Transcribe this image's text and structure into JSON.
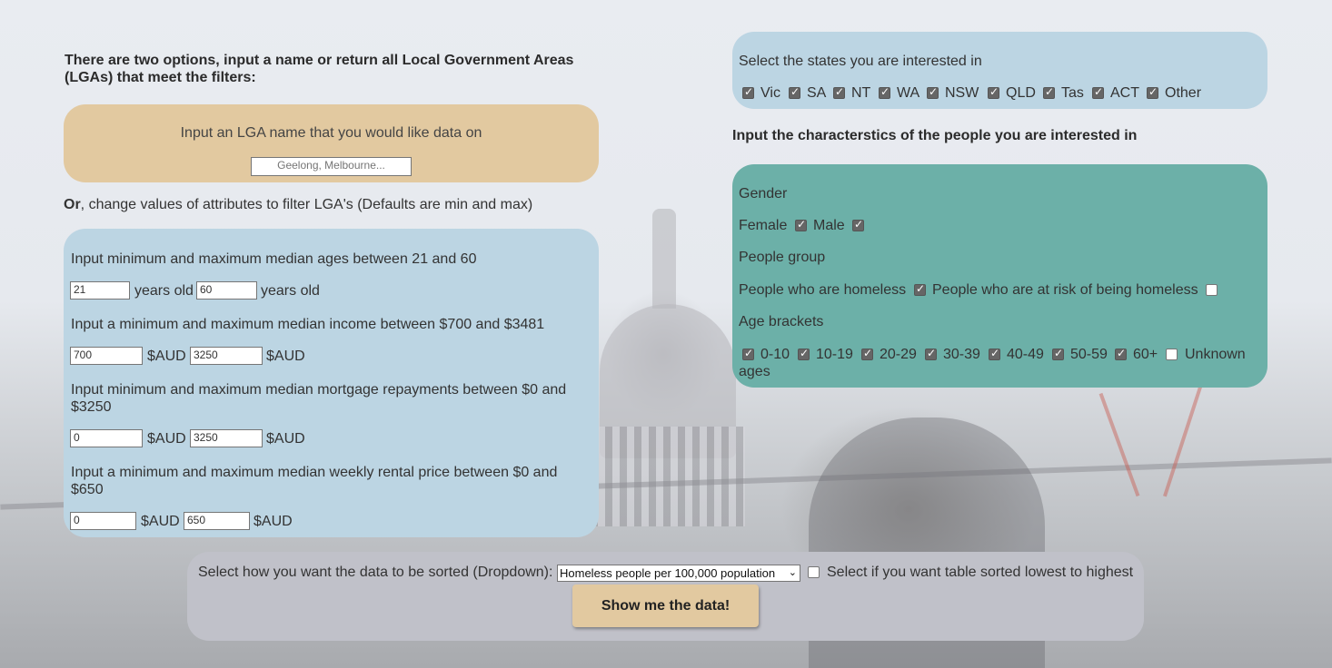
{
  "intro": "There are two options, input a name or return all Local Government Areas (LGAs) that meet the filters:",
  "lga": {
    "label": "Input an LGA name that you would like data on",
    "placeholder": "Geelong, Melbourne..."
  },
  "or_line": {
    "bold": "Or",
    "rest": ", change values of attributes to filter LGA's (Defaults are min and max)"
  },
  "attributes": {
    "age_label": "Input minimum and maximum median ages between 21 and 60",
    "age_min": "21",
    "age_max": "60",
    "years_old": "years old",
    "income_label": "Input a minimum and maximum median income between $700 and $3481",
    "income_min": "700",
    "income_max": "3250",
    "mortgage_label": "Input minimum and maximum median mortgage repayments between $0 and $3250",
    "mortgage_min": "0",
    "mortgage_max": "3250",
    "rent_label": "Input a minimum and maximum median weekly rental price between $0 and $650",
    "rent_min": "0",
    "rent_max": "650",
    "currency": "$AUD"
  },
  "states": {
    "label": "Select the states you are interested in",
    "items": [
      {
        "label": "Vic",
        "checked": true
      },
      {
        "label": "SA",
        "checked": true
      },
      {
        "label": "NT",
        "checked": true
      },
      {
        "label": "WA",
        "checked": true
      },
      {
        "label": "NSW",
        "checked": true
      },
      {
        "label": "QLD",
        "checked": true
      },
      {
        "label": "Tas",
        "checked": true
      },
      {
        "label": "ACT",
        "checked": true
      },
      {
        "label": "Other",
        "checked": true
      }
    ]
  },
  "characteristics_title": "Input the characterstics of the people you are interested in",
  "people": {
    "gender_label": "Gender",
    "female": "Female",
    "male": "Male",
    "group_label": "People group",
    "homeless": "People who are homeless",
    "at_risk": "People who are at risk of being homeless",
    "age_brackets_label": "Age brackets",
    "brackets": [
      {
        "label": "0-10",
        "checked": true
      },
      {
        "label": "10-19",
        "checked": true
      },
      {
        "label": "20-29",
        "checked": true
      },
      {
        "label": "30-39",
        "checked": true
      },
      {
        "label": "40-49",
        "checked": true
      },
      {
        "label": "50-59",
        "checked": true
      },
      {
        "label": "60+",
        "checked": true
      },
      {
        "label": "Unknown",
        "checked": false
      }
    ],
    "ages_suffix": "ages"
  },
  "sort": {
    "label": "Select how you want the data to be sorted (Dropdown):",
    "selected": "Homeless people per 100,000 population",
    "asc_label": "Select if you want table sorted lowest to highest",
    "button": "Show me the data!"
  }
}
